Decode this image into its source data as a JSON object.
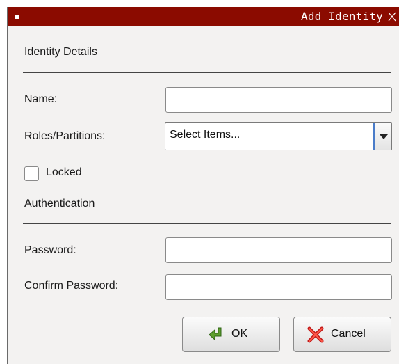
{
  "window": {
    "title": "Add Identity",
    "accent_color": "#8b0b00"
  },
  "sections": {
    "identity_details": "Identity Details",
    "authentication": "Authentication"
  },
  "fields": {
    "name": {
      "label": "Name:",
      "value": ""
    },
    "roles": {
      "label": "Roles/Partitions:",
      "value": "Select Items..."
    },
    "locked": {
      "label": "Locked",
      "checked": false
    },
    "password": {
      "label": "Password:",
      "value": ""
    },
    "confirm_password": {
      "label": "Confirm Password:",
      "value": ""
    }
  },
  "buttons": {
    "ok": {
      "label": "OK",
      "icon": "green-arrow-icon"
    },
    "cancel": {
      "label": "Cancel",
      "icon": "red-x-icon"
    }
  }
}
